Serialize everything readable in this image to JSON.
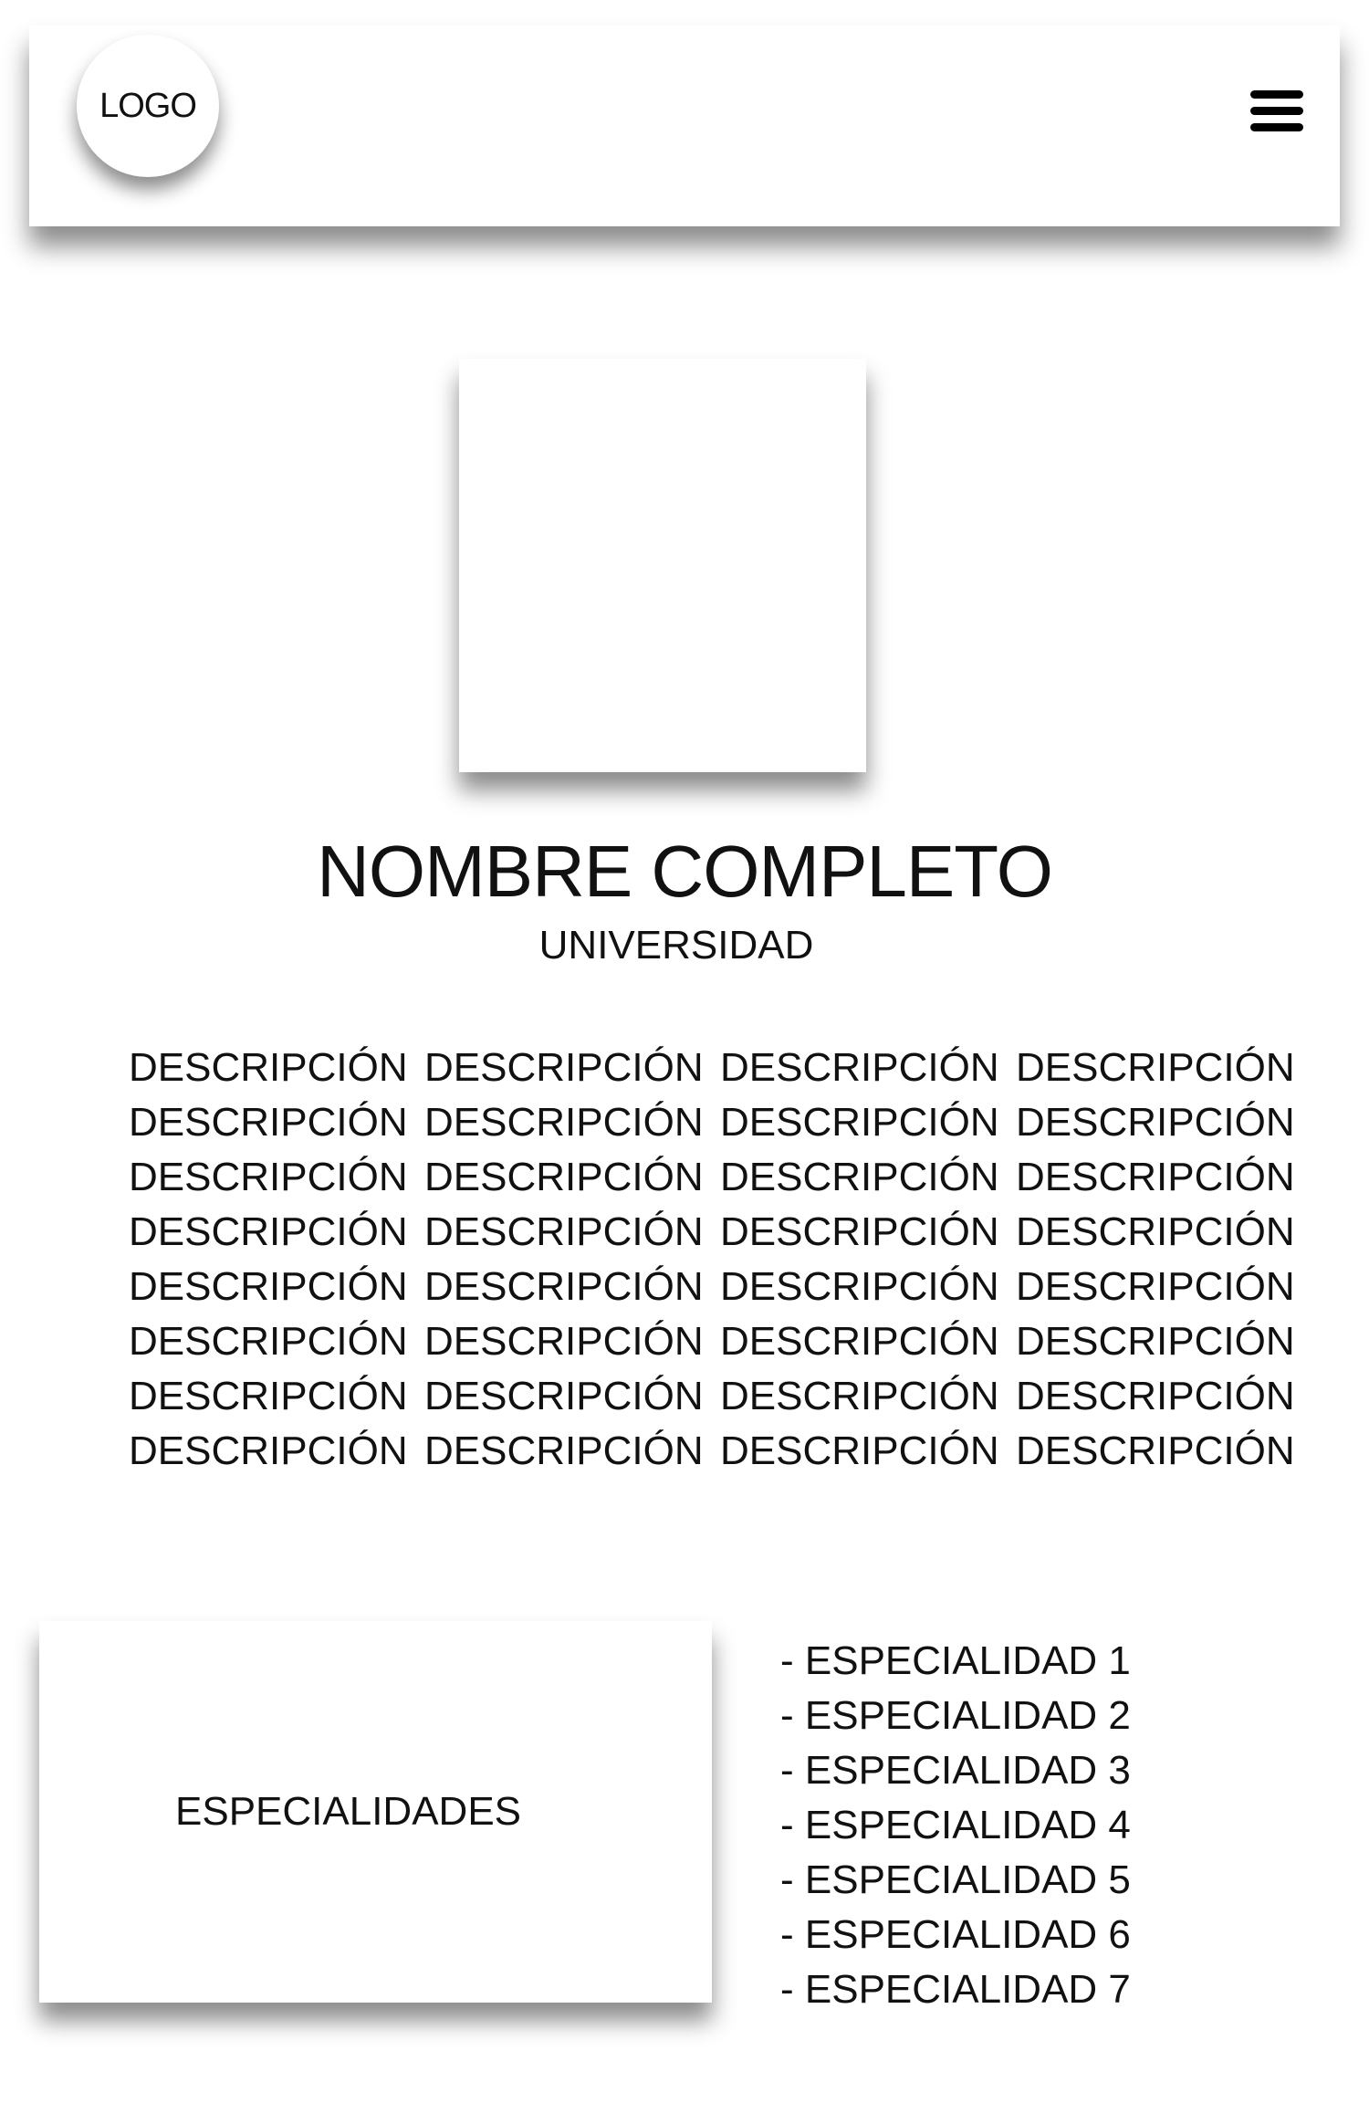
{
  "header": {
    "logo_text": "LOGO",
    "menu_icon": "hamburger-menu-icon"
  },
  "profile": {
    "name": "NOMBRE COMPLETO",
    "university": "UNIVERSIDAD"
  },
  "description": {
    "rows": [
      [
        "DESCRIPCIÓN",
        "DESCRIPCIÓN",
        "DESCRIPCIÓN",
        "DESCRIPCIÓN"
      ],
      [
        "DESCRIPCIÓN",
        "DESCRIPCIÓN",
        "DESCRIPCIÓN",
        "DESCRIPCIÓN"
      ],
      [
        "DESCRIPCIÓN",
        "DESCRIPCIÓN",
        "DESCRIPCIÓN",
        "DESCRIPCIÓN"
      ],
      [
        "DESCRIPCIÓN",
        "DESCRIPCIÓN",
        "DESCRIPCIÓN",
        "DESCRIPCIÓN"
      ],
      [
        "DESCRIPCIÓN",
        "DESCRIPCIÓN",
        "DESCRIPCIÓN",
        "DESCRIPCIÓN"
      ],
      [
        "DESCRIPCIÓN",
        "DESCRIPCIÓN",
        "DESCRIPCIÓN",
        "DESCRIPCIÓN"
      ],
      [
        "DESCRIPCIÓN",
        "DESCRIPCIÓN",
        "DESCRIPCIÓN",
        "DESCRIPCIÓN"
      ],
      [
        "DESCRIPCIÓN",
        "DESCRIPCIÓN",
        "DESCRIPCIÓN",
        "DESCRIPCIÓN"
      ]
    ]
  },
  "specialties": {
    "title": "ESPECIALIDADES",
    "items": [
      "- ESPECIALIDAD 1",
      "- ESPECIALIDAD 2",
      "- ESPECIALIDAD 3",
      "- ESPECIALIDAD 4",
      "- ESPECIALIDAD 5",
      "- ESPECIALIDAD 6",
      "- ESPECIALIDAD 7"
    ]
  }
}
